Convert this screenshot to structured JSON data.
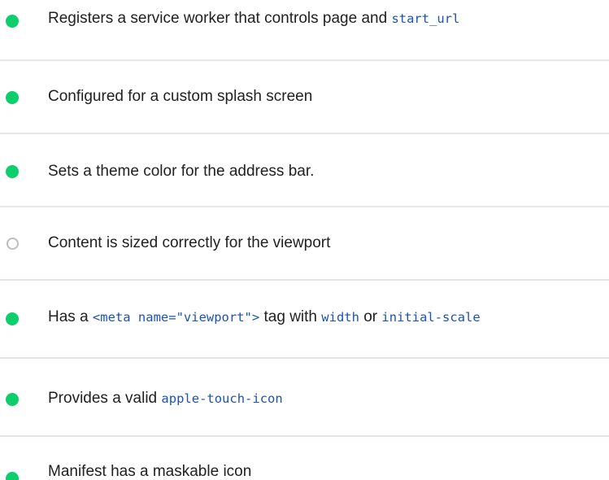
{
  "colors": {
    "pass": "#0cce6b",
    "not_applicable": "#bdbdbd",
    "code": "#1a53b4",
    "divider": "#e6e6e6"
  },
  "audits": [
    {
      "status": "pass",
      "status_icon": "pass-circle-icon",
      "parts": [
        "Registers a service worker that controls page and ",
        "start_url"
      ]
    },
    {
      "status": "pass",
      "status_icon": "pass-circle-icon",
      "parts": [
        "Configured for a custom splash screen"
      ]
    },
    {
      "status": "pass",
      "status_icon": "pass-circle-icon",
      "parts": [
        "Sets a theme color for the address bar."
      ]
    },
    {
      "status": "not_applicable",
      "status_icon": "hollow-circle-icon",
      "parts": [
        "Content is sized correctly for the viewport"
      ]
    },
    {
      "status": "pass",
      "status_icon": "pass-circle-icon",
      "parts": [
        "Has a ",
        "<meta name=\"viewport\">",
        " tag with ",
        "width",
        " or ",
        "initial-scale"
      ]
    },
    {
      "status": "pass",
      "status_icon": "pass-circle-icon",
      "parts": [
        "Provides a valid ",
        "apple-touch-icon"
      ]
    },
    {
      "status": "pass",
      "status_icon": "pass-circle-icon",
      "parts": [
        "Manifest has a maskable icon"
      ]
    }
  ]
}
